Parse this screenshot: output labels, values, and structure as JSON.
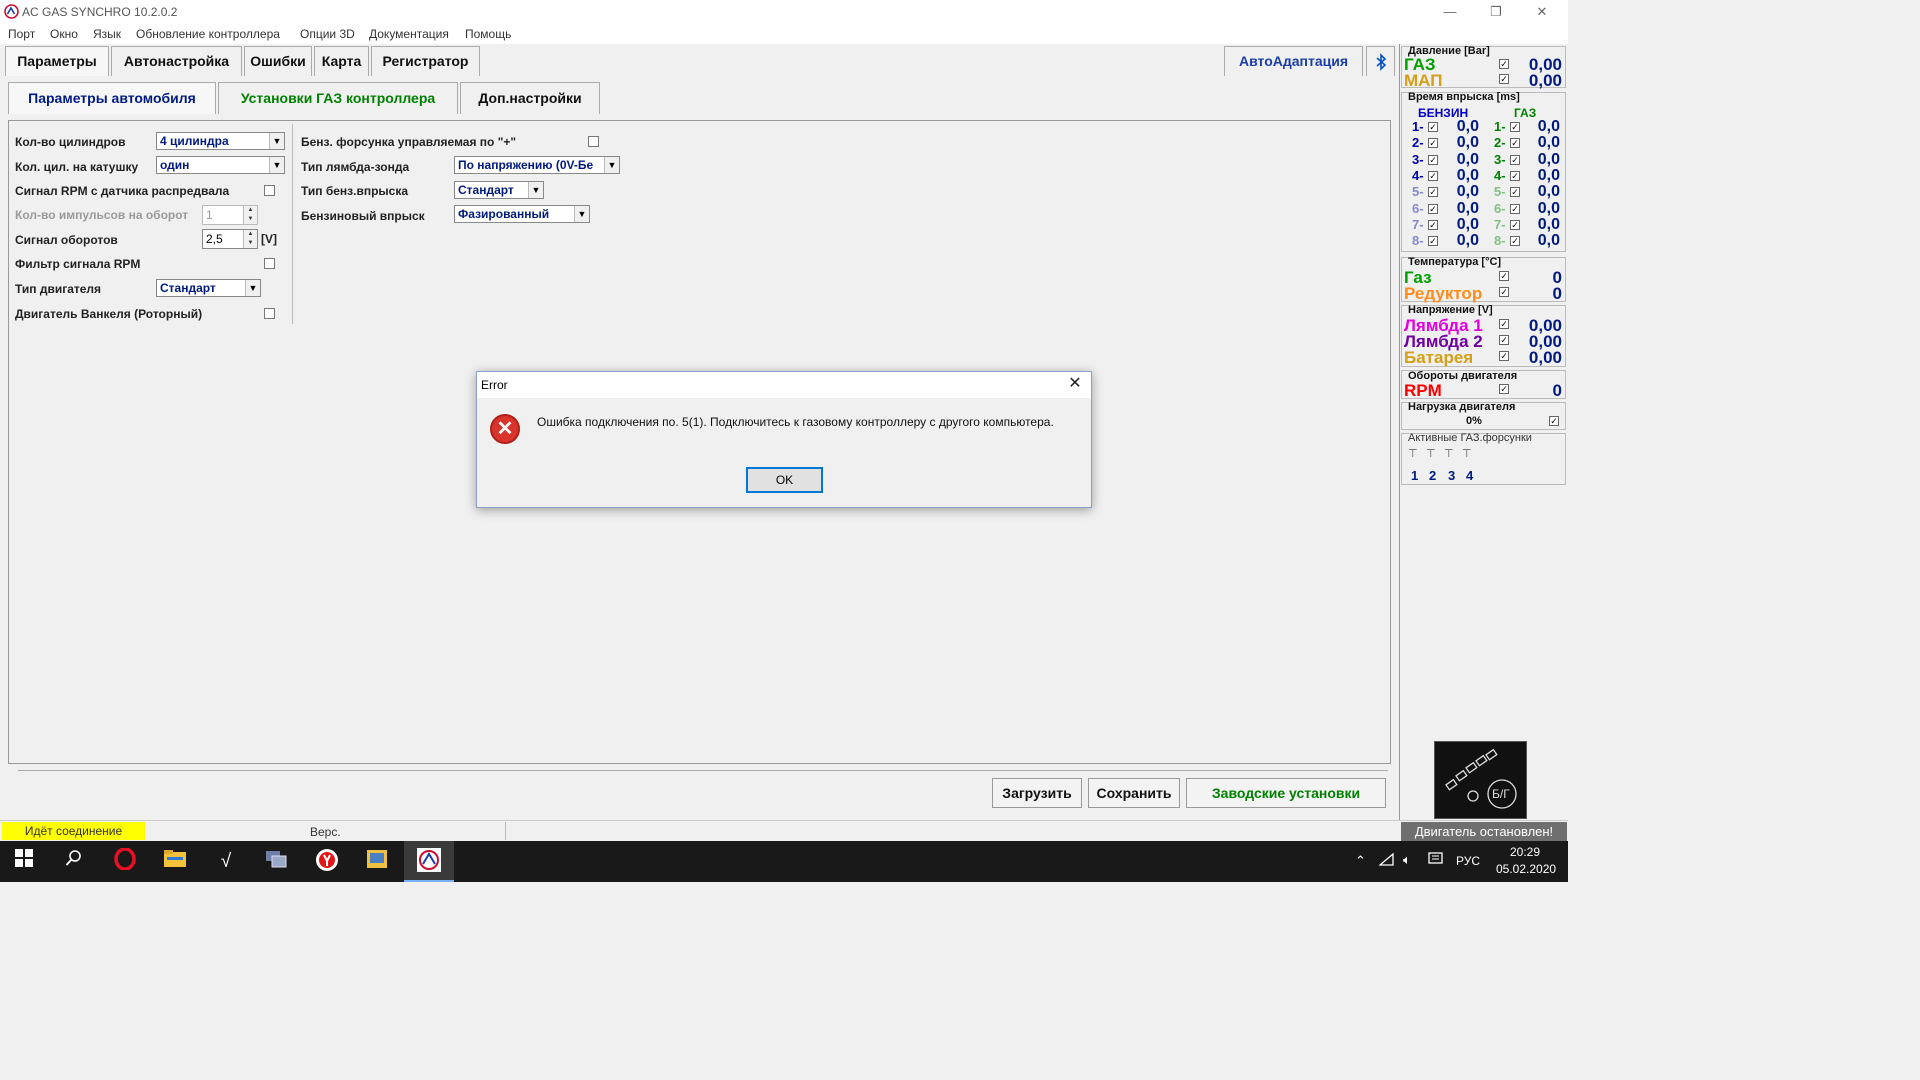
{
  "window": {
    "title": "AC GAS SYNCHRO  10.2.0.2",
    "minimize": "—",
    "restore": "❐",
    "close": "✕"
  },
  "menu": [
    "Порт",
    "Окно",
    "Язык",
    "Обновление контроллера",
    "Опции 3D",
    "Документация",
    "Помощь"
  ],
  "tabs": [
    "Параметры",
    "Автонастройка",
    "Ошибки",
    "Карта",
    "Регистратор"
  ],
  "auto_adapt_label": "АвтоАдаптация",
  "bluetooth_icon": "bluetooth-icon",
  "subtabs": [
    "Параметры автомобиля",
    "Установки ГАЗ контроллера",
    "Доп.настройки"
  ],
  "params_left": {
    "cylinders_label": "Кол-во цилиндров",
    "cylinders_value": "4 цилиндра",
    "coil_label": "Кол. цил. на катушку",
    "coil_value": "один",
    "rpm_cam_label": "Сигнал RPM с датчика распредвала",
    "pulses_label": "Кол-во импульсов на оборот",
    "pulses_value": "1",
    "rpm_signal_label": "Сигнал оборотов",
    "rpm_signal_value": "2,5",
    "rpm_signal_unit": "[V]",
    "rpm_filter_label": "Фильтр сигнала RPM",
    "engine_type_label": "Тип двигателя",
    "engine_type_value": "Стандарт",
    "wankel_label": "Двигатель Ванкеля (Роторный)"
  },
  "params_right": {
    "plus_injector_label": "Бенз. форсунка управляемая по \"+\"",
    "lambda_type_label": "Тип лямбда-зонда",
    "lambda_type_value": "По напряжению  (0V-Бе",
    "petrol_injection_type_label": "Тип бенз.впрыска",
    "petrol_injection_type_value": "Стандарт",
    "petrol_injection_label": "Бензиновый впрыск",
    "petrol_injection_value": "Фазированный"
  },
  "buttons": {
    "load": "Загрузить",
    "save": "Сохранить",
    "factory": "Заводские установки"
  },
  "status": {
    "connection": "Идёт соединение",
    "version": "Верс.",
    "engine": "Двигатель остановлен!"
  },
  "sensors": {
    "pressure_title": "Давление [Bar]",
    "gas_label": "ГАЗ",
    "gas_value": "0,00",
    "map_label": "МАП",
    "map_value": "0,00",
    "injection_title": "Время впрыска [ms]",
    "petrol_header": "БЕНЗИН",
    "gas_header": "ГАЗ",
    "injection_rows": [
      {
        "num": "1-",
        "petrol": "0,0",
        "gas": "0,0"
      },
      {
        "num": "2-",
        "petrol": "0,0",
        "gas": "0,0"
      },
      {
        "num": "3-",
        "petrol": "0,0",
        "gas": "0,0"
      },
      {
        "num": "4-",
        "petrol": "0,0",
        "gas": "0,0"
      },
      {
        "num": "5-",
        "petrol": "0,0",
        "gas": "0,0"
      },
      {
        "num": "6-",
        "petrol": "0,0",
        "gas": "0,0"
      },
      {
        "num": "7-",
        "petrol": "0,0",
        "gas": "0,0"
      },
      {
        "num": "8-",
        "petrol": "0,0",
        "gas": "0,0"
      }
    ],
    "temp_title": "Температура  [°С]",
    "temp_gas_label": "Газ",
    "temp_gas_value": "0",
    "temp_reducer_label": "Редуктор",
    "temp_reducer_value": "0",
    "voltage_title": "Напряжение  [V]",
    "lambda1_label": "Лямбда 1",
    "lambda1_value": "0,00",
    "lambda2_label": "Лямбда 2",
    "lambda2_value": "0,00",
    "battery_label": "Батарея",
    "battery_value": "0,00",
    "rpm_title": "Обороты двигателя",
    "rpm_label": "RPM",
    "rpm_value": "0",
    "load_title": "Нагрузка двигателя",
    "load_value": "0%",
    "active_injectors_title": "Активные ГАЗ.форсунки",
    "active_injectors": [
      "1",
      "2",
      "3",
      "4"
    ],
    "gauge_label": "Б/Г"
  },
  "colors": {
    "gas": "#00a000",
    "map": "#d4a017",
    "reducer": "#ff8c1a",
    "lambda1": "#e000e0",
    "lambda2": "#7000a0",
    "battery": "#d4a017",
    "rpm": "#ff0000",
    "value": "#001a80",
    "status_yellow": "#ffff00",
    "subtab_green": "#008000",
    "subtab_blue": "#001a80"
  },
  "dialog": {
    "title": "Error",
    "message": "Ошибка подключения по. 5(1). Подключитесь к газовому контроллеру с другого компьютера.",
    "ok": "OK"
  },
  "taskbar": {
    "time": "20:29",
    "date": "05.02.2020",
    "lang": "РУС",
    "icons": [
      "windows-start-icon",
      "search-icon",
      "opera-icon",
      "file-explorer-icon",
      "checkmark-app-icon",
      "network-app-icon",
      "yandex-browser-icon",
      "photo-app-icon",
      "ac-gas-app-icon"
    ]
  }
}
